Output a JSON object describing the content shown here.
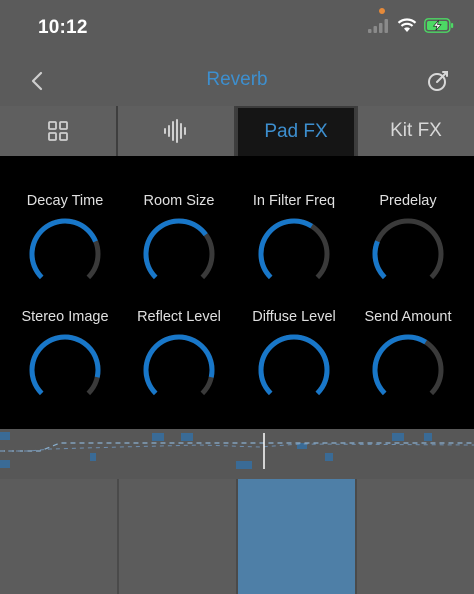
{
  "status_bar": {
    "time": "10:12",
    "icons": [
      "signal-icon",
      "wifi-icon",
      "battery-charging-icon"
    ]
  },
  "nav": {
    "title": "Reverb",
    "back_icon": "chevron-left-icon",
    "right_icon": "tuning-icon"
  },
  "tabs": [
    {
      "label": "",
      "icon": "grid-icon",
      "active": false
    },
    {
      "label": "",
      "icon": "waveform-icon",
      "active": false
    },
    {
      "label": "Pad FX",
      "icon": "",
      "active": true
    },
    {
      "label": "Kit FX",
      "icon": "",
      "active": false
    }
  ],
  "knobs": [
    {
      "label": "Decay Time",
      "value": 0.75
    },
    {
      "label": "Room Size",
      "value": 0.7
    },
    {
      "label": "In Filter Freq",
      "value": 0.62
    },
    {
      "label": "Predelay",
      "value": 0.25
    },
    {
      "label": "Stereo Image",
      "value": 0.88
    },
    {
      "label": "Reflect Level",
      "value": 0.88
    },
    {
      "label": "Diffuse Level",
      "value": 1.0
    },
    {
      "label": "Send Amount",
      "value": 0.62
    }
  ],
  "colors": {
    "accent": "#1877c9",
    "track": "#3a3a3a",
    "title": "#3d8fcf",
    "active_pad": "#4e7fa7"
  }
}
